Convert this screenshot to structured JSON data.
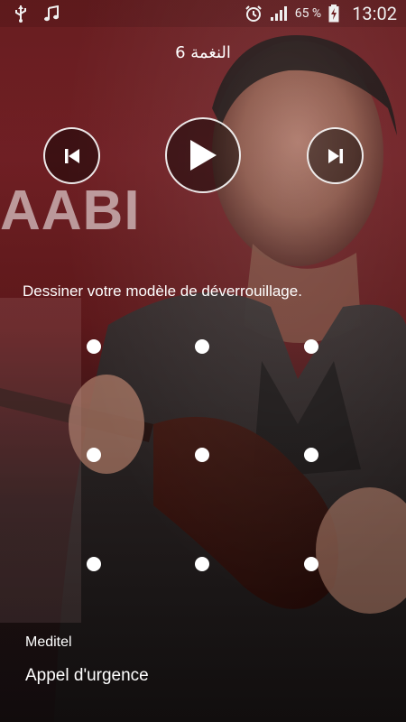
{
  "status_bar": {
    "icons_left": [
      "usb-icon",
      "music-note-icon"
    ],
    "icons_right": [
      "alarm-clock-icon",
      "signal-icon",
      "battery-charging-icon"
    ],
    "battery_percent": "65 %",
    "time": "13:02"
  },
  "background": {
    "brand_text": "AABI",
    "accent_color": "#7a2227"
  },
  "player": {
    "track_title": "النغمة 6",
    "controls": [
      "previous-icon",
      "play-icon",
      "next-icon"
    ]
  },
  "lockscreen": {
    "instruction": "Dessiner votre modèle de déverrouillage.",
    "pattern_dots": 9
  },
  "footer": {
    "carrier": "Meditel",
    "emergency_call": "Appel d'urgence"
  }
}
